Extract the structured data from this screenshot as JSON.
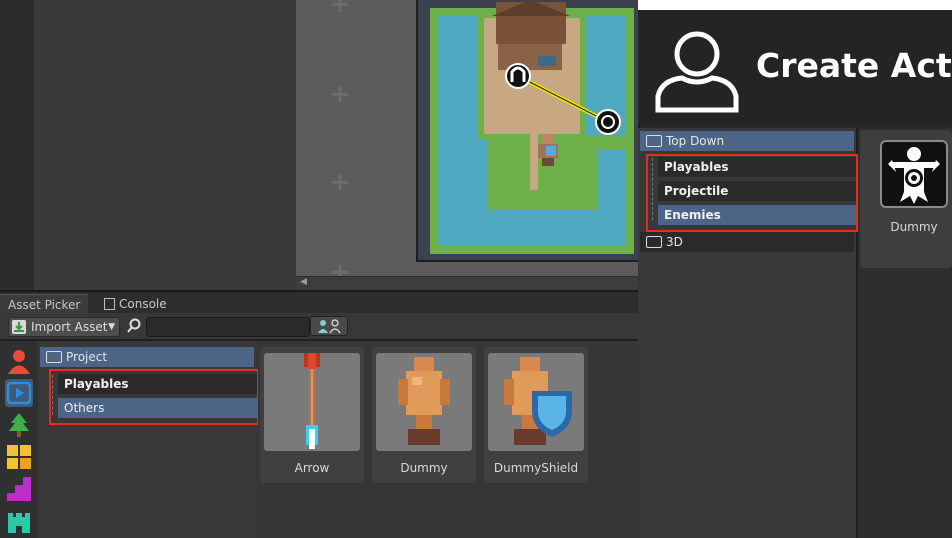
{
  "bottom_panel": {
    "tabs": [
      {
        "label": "Asset Picker",
        "active": true
      },
      {
        "label": "Console",
        "icon": "console-icon"
      }
    ],
    "toolbar": {
      "import_label": "Import Asset",
      "search_placeholder": ""
    },
    "categories": [
      {
        "icon": "actor-icon",
        "color": "#e84a3c"
      },
      {
        "icon": "playable-icon",
        "color": "#2e8fd8"
      },
      {
        "icon": "tree-icon",
        "color": "#3cb04a"
      },
      {
        "icon": "tiles-icon",
        "color": "#f2c230"
      },
      {
        "icon": "stairs-icon",
        "color": "#c02cc8"
      },
      {
        "icon": "castle-icon",
        "color": "#2cc8a8"
      }
    ],
    "tree": {
      "root": "Project",
      "items": [
        {
          "label": "Playables",
          "selected": false
        },
        {
          "label": "Others",
          "selected": true
        }
      ]
    },
    "assets": [
      {
        "label": "Arrow",
        "icon": "arrow-sprite"
      },
      {
        "label": "Dummy",
        "icon": "dummy-sprite"
      },
      {
        "label": "DummyShield",
        "icon": "dummy-shield-sprite"
      }
    ]
  },
  "right_panel": {
    "title": "Create Actor",
    "tree": {
      "root": "Top Down",
      "items": [
        {
          "label": "Playables",
          "selected": false
        },
        {
          "label": "Projectile",
          "selected": false
        },
        {
          "label": "Enemies",
          "selected": true
        }
      ],
      "other_root": "3D"
    },
    "assets": [
      {
        "label": "Dummy",
        "icon": "scarecrow-target-icon"
      }
    ]
  },
  "colors": {
    "selection": "#4c6486",
    "highlight_box": "#e0301c",
    "water": "#4ea8c0",
    "grass": "#6db04a",
    "ground": "#c8a882"
  }
}
